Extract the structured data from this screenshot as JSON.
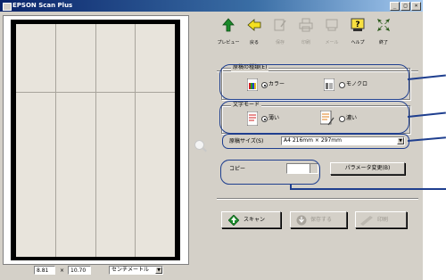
{
  "window": {
    "title": "EPSON Scan Plus"
  },
  "status": {
    "width": "8.81",
    "times": "×",
    "height": "10.70",
    "unit": "センチメートル"
  },
  "toolbar": {
    "items": [
      {
        "label": "プレビュー",
        "icon": "scan-arrow-icon",
        "enabled": true
      },
      {
        "label": "戻る",
        "icon": "back-arrow-icon",
        "enabled": true
      },
      {
        "label": "保存",
        "icon": "save-edit-icon",
        "enabled": false
      },
      {
        "label": "印刷",
        "icon": "print-icon",
        "enabled": false
      },
      {
        "label": "メール",
        "icon": "mail-icon",
        "enabled": false
      },
      {
        "label": "ヘルプ",
        "icon": "help-icon",
        "enabled": true
      },
      {
        "label": "終了",
        "icon": "exit-icon",
        "enabled": true
      }
    ]
  },
  "image_type": {
    "title": "原稿の種類(E)",
    "options": [
      {
        "label": "カラー",
        "selected": true,
        "icon": "color-photo-icon"
      },
      {
        "label": "モノクロ",
        "selected": false,
        "icon": "mono-photo-icon"
      }
    ]
  },
  "text_mode": {
    "title": "文字モード",
    "options": [
      {
        "label": "薄い",
        "selected": true,
        "icon": "light-text-icon"
      },
      {
        "label": "濃い",
        "selected": false,
        "icon": "dark-text-icon"
      }
    ]
  },
  "document_size": {
    "label": "原稿サイズ(S)",
    "value": "A4 216mm × 297mm"
  },
  "copies": {
    "label": "コピー",
    "value": "",
    "button": "パラメータ変更(B)"
  },
  "actions": {
    "scan": "スキャン",
    "save": "保存する",
    "print": "印刷"
  },
  "colors": {
    "callout": "#1f3f8f",
    "face": "#d4d0c8",
    "titlebar": "#0a246a"
  }
}
